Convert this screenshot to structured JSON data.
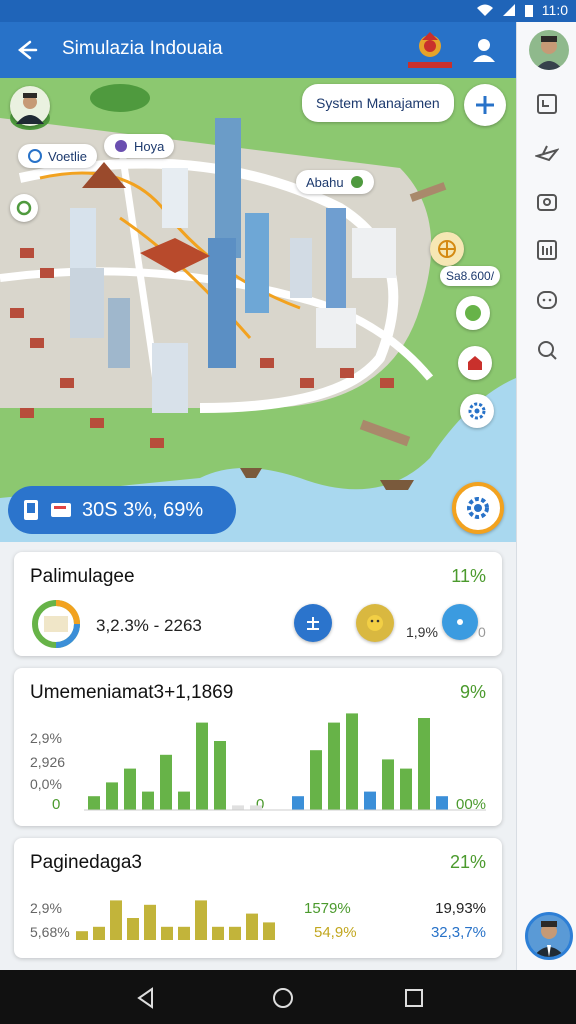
{
  "status": {
    "time": "11:0"
  },
  "appbar": {
    "title": "Simulazia Indouaia"
  },
  "map": {
    "search_chip": "System Manajamen",
    "labels": [
      {
        "text": "Voetlie",
        "icon": "swirl-icon"
      },
      {
        "text": "Hoya",
        "icon": "chat-icon"
      },
      {
        "text": "Abahu",
        "icon": "leaf-icon"
      },
      {
        "text": "Sa8.600/",
        "icon": "wheel-icon"
      }
    ],
    "stats_text": "30S 3%, 69%"
  },
  "cards": [
    {
      "title": "Palimulagee",
      "percent": "11%",
      "value": "3,2.3% - 2263",
      "side_value": "1,9%",
      "side_zero": "0"
    },
    {
      "title": "Umemeniamat3+1,1869",
      "percent": "9%",
      "ticks": [
        "2,9%",
        "2,926",
        "0,0%",
        "0"
      ],
      "mid_zero": "0",
      "right_pct": "00%"
    },
    {
      "title": "Paginedaga3",
      "percent": "21%",
      "ticks": [
        "2,9%",
        "5,68%"
      ],
      "left_vals": [
        "1579%",
        "54,9%"
      ],
      "right_vals": [
        "19,93%",
        "32,3,7%"
      ]
    }
  ],
  "chart_data": [
    {
      "type": "bar",
      "title": "",
      "series": [
        {
          "values": [
            0.3,
            0.6,
            0.9,
            0.4,
            1.2,
            0.4,
            1.9,
            1.5,
            0.1,
            0.1
          ]
        },
        {
          "values": [
            0.3,
            1.3,
            1.9,
            2.1,
            0.4,
            1.1,
            0.9,
            2.0,
            0.3
          ]
        }
      ]
    },
    {
      "type": "bar",
      "title": "",
      "series": [
        {
          "values": [
            0.2,
            0.3,
            0.9,
            0.5,
            0.8,
            0.3,
            0.3,
            0.9,
            0.3,
            0.3,
            0.6,
            0.4
          ]
        }
      ]
    }
  ],
  "colors": {
    "primary": "#2872c8",
    "green": "#67b348",
    "olive": "#c2b43a",
    "blue_bar": "#3b8fd8"
  }
}
